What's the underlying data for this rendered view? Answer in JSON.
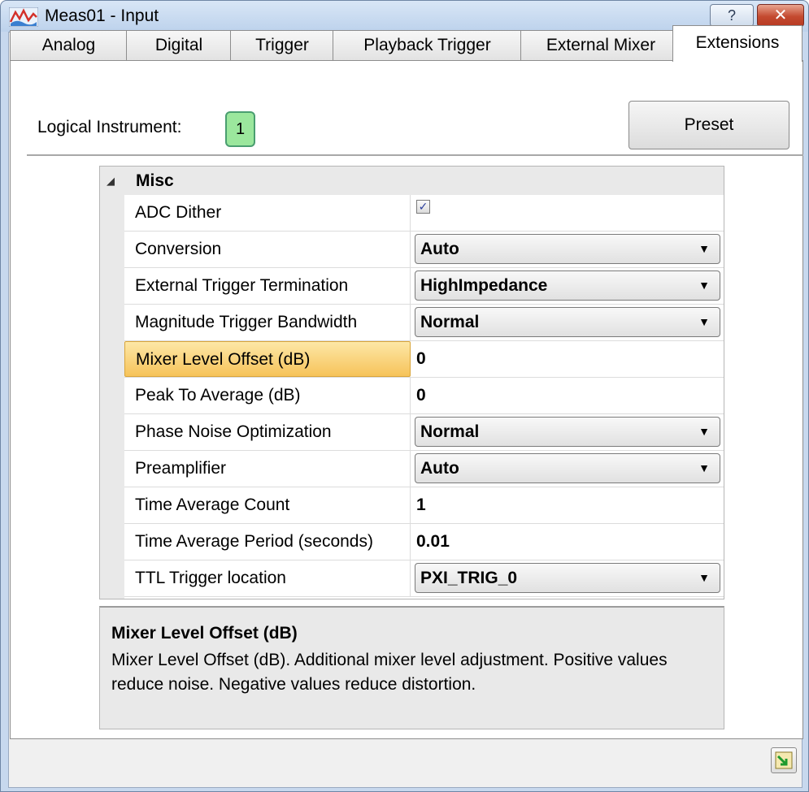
{
  "window": {
    "title": "Meas01 - Input",
    "help_label": "?",
    "close_label": "✕"
  },
  "tabs": [
    {
      "label": "Analog"
    },
    {
      "label": "Digital"
    },
    {
      "label": "Trigger"
    },
    {
      "label": "Playback Trigger"
    },
    {
      "label": "External Mixer"
    },
    {
      "label": "Extensions",
      "active": true
    }
  ],
  "header": {
    "logical_instrument_label": "Logical Instrument:",
    "logical_instrument_value": "1",
    "preset_label": "Preset"
  },
  "grid": {
    "category": "Misc",
    "rows": [
      {
        "name": "ADC Dither",
        "type": "checkbox",
        "checked": true
      },
      {
        "name": "Conversion",
        "type": "combo",
        "value": "Auto"
      },
      {
        "name": "External Trigger Termination",
        "type": "combo",
        "value": "HighImpedance"
      },
      {
        "name": "Magnitude Trigger Bandwidth",
        "type": "combo",
        "value": "Normal"
      },
      {
        "name": "Mixer Level Offset (dB)",
        "type": "text",
        "value": "0",
        "selected": true
      },
      {
        "name": "Peak To Average (dB)",
        "type": "text",
        "value": "0"
      },
      {
        "name": "Phase Noise Optimization",
        "type": "combo",
        "value": "Normal"
      },
      {
        "name": "Preamplifier",
        "type": "combo",
        "value": "Auto"
      },
      {
        "name": "Time Average Count",
        "type": "text",
        "value": "1"
      },
      {
        "name": "Time Average Period (seconds)",
        "type": "text",
        "value": "0.01"
      },
      {
        "name": "TTL Trigger location",
        "type": "combo",
        "value": "PXI_TRIG_0"
      }
    ]
  },
  "description": {
    "title": "Mixer Level Offset (dB)",
    "text": "Mixer Level Offset (dB).  Additional mixer level adjustment.  Positive values reduce noise.  Negative values reduce distortion."
  },
  "icons": {
    "app": "waveform-app-icon",
    "combo_arrow": "chevron-down-icon",
    "collapse": "collapse-triangle-icon",
    "refresh": "refresh-icon"
  },
  "colors": {
    "selected_row": "#f6c35a",
    "logical_instrument_fill": "#9be79d",
    "close_button": "#c44a30"
  }
}
